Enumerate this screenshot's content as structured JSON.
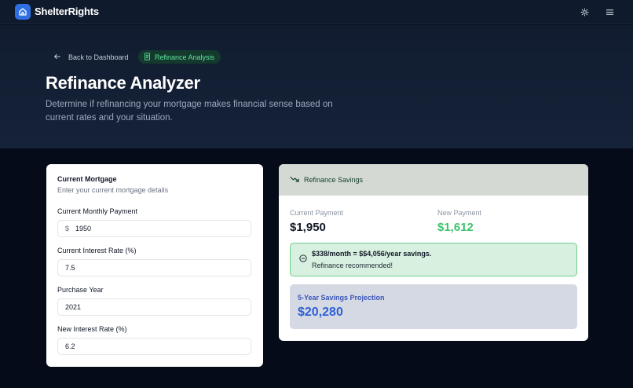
{
  "app": {
    "brand": "ShelterRights"
  },
  "hero": {
    "back_label": "Back to Dashboard",
    "crumb_label": "Refinance Analysis",
    "title": "Refinance Analyzer",
    "subtitle": "Determine if refinancing your mortgage makes financial sense based on current rates and your situation."
  },
  "form": {
    "title": "Current Mortgage",
    "description": "Enter your current mortgage details",
    "fields": [
      {
        "label": "Current Monthly Payment",
        "value": "1950",
        "prefix": "$"
      },
      {
        "label": "Current Interest Rate (%)",
        "value": "7.5"
      },
      {
        "label": "Purchase Year",
        "value": "2021"
      },
      {
        "label": "New Interest Rate (%)",
        "value": "6.2"
      }
    ]
  },
  "results": {
    "header": "Refinance Savings",
    "current_label": "Current Payment",
    "current_value": "$1,950",
    "new_label": "New Payment",
    "new_value": "$1,612",
    "savings_main": "$338/month = $$4,056/year savings.",
    "savings_sub": "Refinance recommended!",
    "projection_label": "5-Year Savings Projection",
    "projection_value": "$20,280"
  },
  "icons": {
    "logo": "home-icon",
    "theme": "sun-icon",
    "menu": "menu-icon",
    "back": "arrow-left-icon",
    "crumb": "document-icon",
    "header": "trending-down-icon",
    "savings": "check-circle-icon"
  },
  "colors": {
    "accent_blue": "#2f6fe4",
    "success_green": "#4ccb7a",
    "new_payment_green": "#3ec46d",
    "projection_blue": "#2e5fd6"
  }
}
